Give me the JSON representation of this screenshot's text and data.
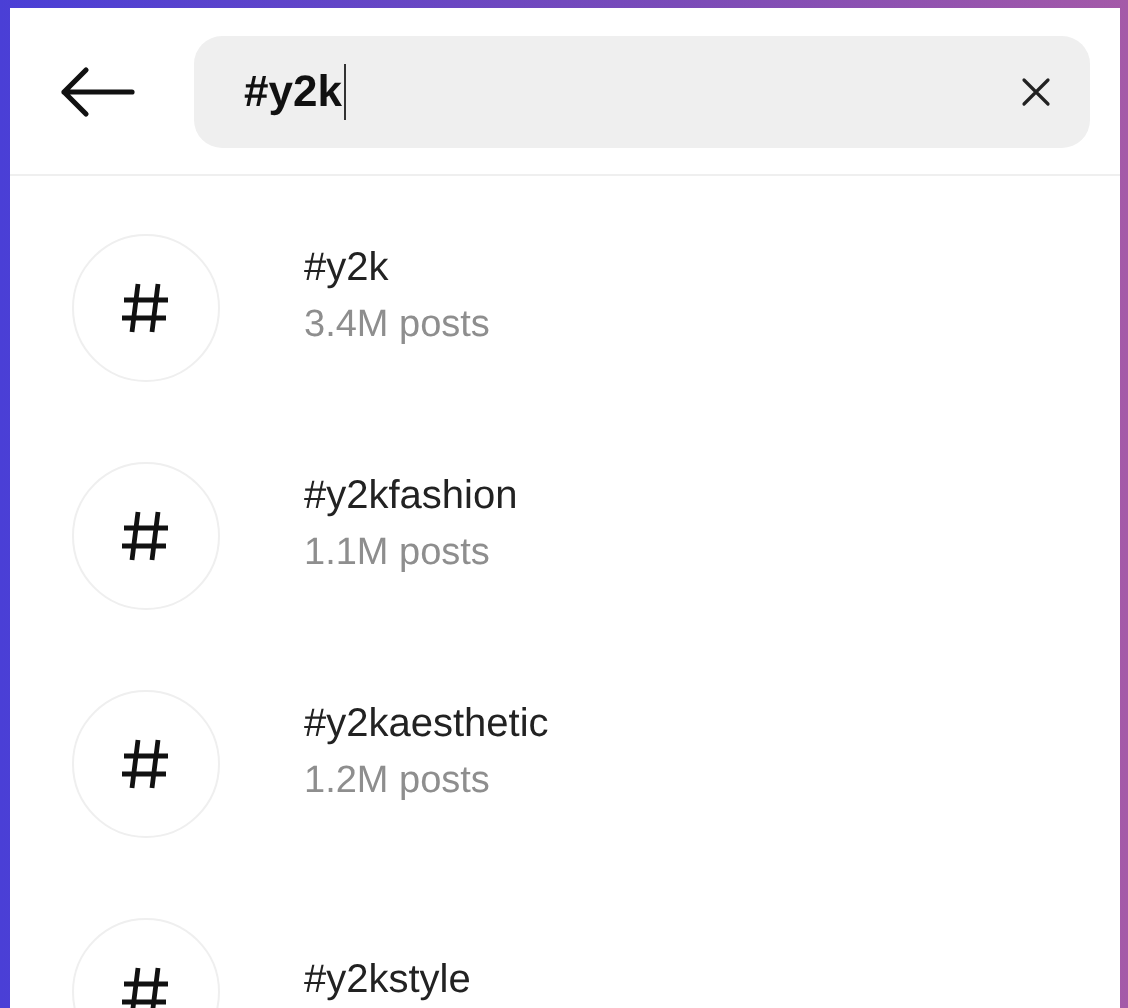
{
  "search": {
    "value": "#y2k"
  },
  "results": [
    {
      "title": "#y2k",
      "subtitle": "3.4M posts"
    },
    {
      "title": "#y2kfashion",
      "subtitle": "1.1M posts"
    },
    {
      "title": "#y2kaesthetic",
      "subtitle": "1.2M posts"
    },
    {
      "title": "#y2kstyle"
    }
  ]
}
